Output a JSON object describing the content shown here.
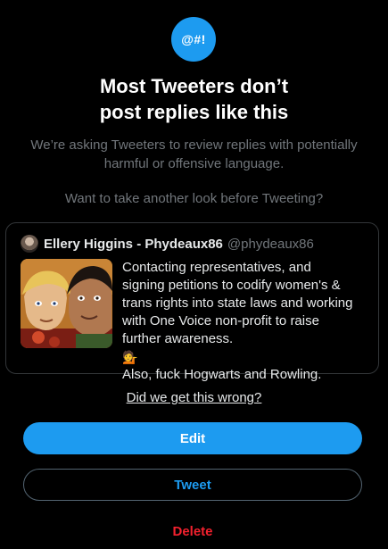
{
  "badge": {
    "label": "@#!"
  },
  "title": {
    "line1": "Most Tweeters don’t",
    "line2": "post replies like this"
  },
  "subtitle": "We’re asking Tweeters to review replies with potentially harmful or offensive language.",
  "question": "Want to take another look before Tweeting?",
  "tweet": {
    "display_name": "Ellery Higgins - Phydeaux86",
    "handle": "@phydeaux86",
    "lines": [
      "Contacting representatives, and",
      "signing petitions to codify women's &",
      "trans rights into state laws and working",
      "with One Voice non-profit to raise",
      "further awareness.",
      "Also, fuck Hogwarts and Rowling."
    ],
    "emoji": "💁"
  },
  "feedback_link": "Did we get this wrong?",
  "buttons": {
    "edit": "Edit",
    "tweet": "Tweet",
    "delete": "Delete"
  },
  "colors": {
    "accent": "#1d9bf0",
    "danger": "#f4212e",
    "background": "#000000",
    "muted_text": "#71767b"
  }
}
